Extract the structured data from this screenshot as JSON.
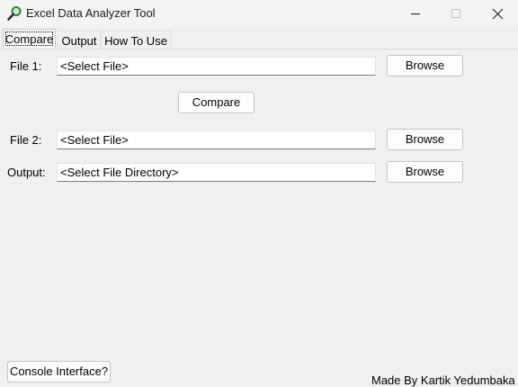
{
  "window": {
    "title": "Excel Data Analyzer Tool",
    "icon": "magnifier-icon",
    "controls": [
      "minimize-icon",
      "maximize-icon",
      "close-icon"
    ]
  },
  "tabs": [
    {
      "label": "Compare",
      "selected": true
    },
    {
      "label": "Output",
      "selected": false
    },
    {
      "label": "How To Use",
      "selected": false
    }
  ],
  "compare_tab": {
    "file1": {
      "label": "File 1:",
      "value": "<Select File>",
      "browse_label": "Browse"
    },
    "compare_label": "Compare",
    "file2": {
      "label": "File 2:",
      "value": "<Select File>",
      "browse_label": "Browse"
    },
    "output": {
      "label": "Output:",
      "value": "<Select File Directory>",
      "browse_label": "Browse"
    }
  },
  "footer": {
    "console_label": "Console Interface?",
    "credit": "Made By Kartik Yedumbaka"
  },
  "colors": {
    "window_bg": "#f0f0f0",
    "field_bg": "#ffffff",
    "button_bg": "#fdfdfd"
  }
}
